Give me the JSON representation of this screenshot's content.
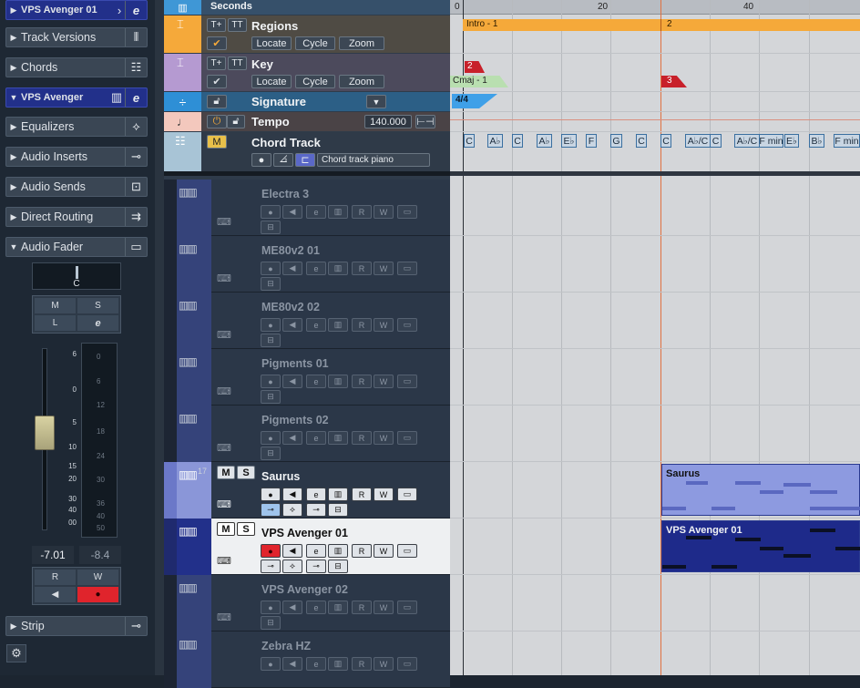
{
  "inspector": {
    "track_name": "VPS Avenger 01",
    "sections": [
      {
        "label": "Track Versions",
        "icon": "versions-icon"
      },
      {
        "label": "Chords",
        "icon": "chords-icon"
      },
      {
        "label": "VPS Avenger",
        "icon": "edit-instrument-icon"
      },
      {
        "label": "Equalizers",
        "icon": "eq-icon"
      },
      {
        "label": "Audio Inserts",
        "icon": "inserts-icon"
      },
      {
        "label": "Audio Sends",
        "icon": "sends-icon"
      },
      {
        "label": "Direct Routing",
        "icon": "routing-icon"
      },
      {
        "label": "Audio Fader",
        "icon": "fader-icon"
      },
      {
        "label": "Strip",
        "icon": "strip-icon"
      }
    ],
    "pan_value": "C",
    "fader_scale": [
      "6",
      "0",
      "5",
      "10",
      "15",
      "20",
      "30",
      "40",
      "00"
    ],
    "meter_scale": [
      "0",
      "6",
      "12",
      "18",
      "24",
      "30",
      "36",
      "40",
      "50"
    ],
    "volume": "-7.01",
    "peak": "-8.4",
    "ms": {
      "mute": "M",
      "solo": "S",
      "listen": "L",
      "edit": "e"
    },
    "rw": {
      "read": "R",
      "write": "W"
    }
  },
  "ruler": {
    "label": "Seconds",
    "marks": [
      "0",
      "20",
      "40"
    ]
  },
  "global_tracks": {
    "regions": {
      "name": "Regions",
      "buttons": [
        "Locate",
        "Cycle",
        "Zoom"
      ]
    },
    "key": {
      "name": "Key",
      "buttons": [
        "Locate",
        "Cycle",
        "Zoom"
      ]
    },
    "signature": {
      "name": "Signature"
    },
    "tempo": {
      "name": "Tempo",
      "value": "140.000"
    },
    "chord_track": {
      "name": "Chord Track",
      "instrument": "Chord track piano"
    }
  },
  "instrument_tracks": [
    {
      "name": "Electra 3",
      "active": false
    },
    {
      "name": "ME80v2 01",
      "active": false
    },
    {
      "name": "ME80v2 02",
      "active": false
    },
    {
      "name": "Pigments 01",
      "active": false
    },
    {
      "name": "Pigments 02",
      "active": false
    },
    {
      "name": "Saurus",
      "active": true,
      "number": "17"
    },
    {
      "name": "VPS Avenger 01",
      "active": true,
      "selected": true
    },
    {
      "name": "VPS Avenger 02",
      "active": false
    },
    {
      "name": "Zebra HZ",
      "active": false
    }
  ],
  "track_buttons": {
    "mute": "M",
    "solo": "S",
    "read": "R",
    "write": "W"
  },
  "arrange": {
    "regions": [
      "Intro -  1",
      "2"
    ],
    "key_events": [
      "2",
      "Cmaj -  1",
      "3"
    ],
    "signature": "4/4",
    "chords": [
      "C",
      "A♭",
      "C",
      "A♭",
      "E♭",
      "F",
      "G",
      "C",
      "C",
      "A♭/C",
      "C",
      "A♭/C",
      "F min",
      "E♭",
      "B♭",
      "F min"
    ],
    "parts": [
      "Saurus",
      "VPS Avenger 01"
    ]
  },
  "colors": {
    "accent": "#22308a",
    "regions": "#f5a93a",
    "key": "#b59ad1",
    "signature": "#2e8fd6",
    "tempo": "#f3c8bd",
    "chord": "#a8c4d6",
    "record": "#e0242c"
  }
}
